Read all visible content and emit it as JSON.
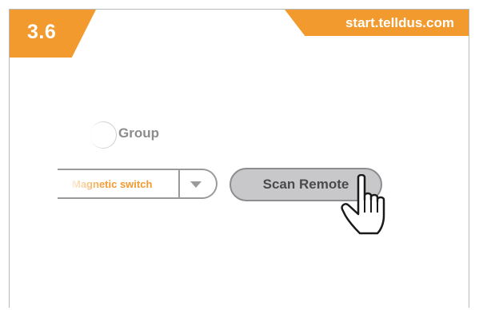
{
  "step": {
    "number": "3.6"
  },
  "header": {
    "url": "start.telldus.com"
  },
  "group_option": {
    "label": "Group"
  },
  "device_select": {
    "value": "Magnetic switch"
  },
  "scan_button": {
    "label": "Scan Remote"
  },
  "cursor": {
    "icon": "hand-pointer-icon"
  },
  "colors": {
    "accent": "#f29a2e",
    "button": "#c8c8ca",
    "border": "#9a9a9a"
  }
}
